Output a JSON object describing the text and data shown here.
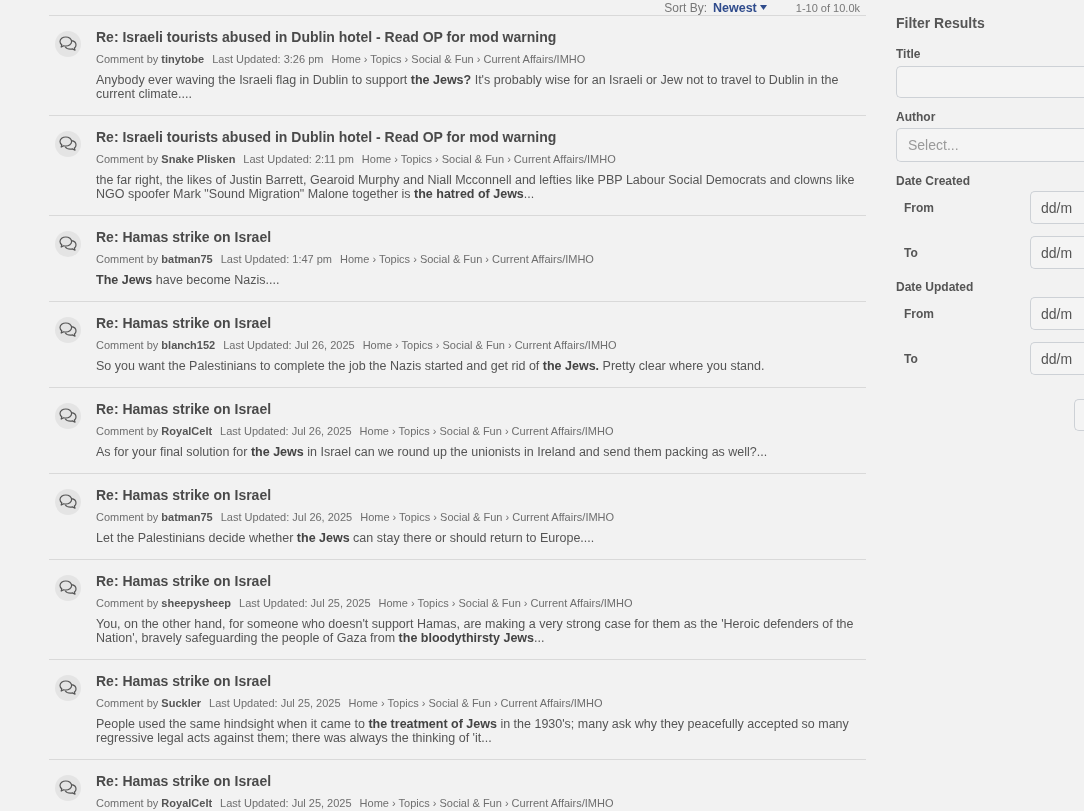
{
  "sort": {
    "label": "Sort By:",
    "value": "Newest"
  },
  "result_count": "1-10 of 10.0k",
  "results": [
    {
      "title": "Re: Israeli tourists abused in Dublin hotel - Read OP for mod warning",
      "author_label": "Comment by",
      "author": "tinytobe",
      "updated": "Last Updated: 3:26 pm",
      "path": "Home › Topics › Social & Fun › Current Affairs/IMHO",
      "excerpt": "Anybody ever waving the Israeli flag in Dublin to support **the Jews?** It's probably wise for an Israeli or Jew not to travel to Dublin in the current climate...."
    },
    {
      "title": "Re: Israeli tourists abused in Dublin hotel - Read OP for mod warning",
      "author_label": "Comment by",
      "author": "Snake Plisken",
      "updated": "Last Updated: 2:11 pm",
      "path": "Home › Topics › Social & Fun › Current Affairs/IMHO",
      "excerpt": "the far right, the likes of Justin Barrett, Gearoid Murphy and Niall Mcconnell and lefties like PBP Labour Social Democrats and clowns like NGO spoofer Mark \"Sound Migration\" Malone together is **the hatred of Jews**..."
    },
    {
      "title": "Re: Hamas strike on Israel",
      "author_label": "Comment by",
      "author": "batman75",
      "updated": "Last Updated: 1:47 pm",
      "path": "Home › Topics › Social & Fun › Current Affairs/IMHO",
      "excerpt": "**The Jews** have become Nazis...."
    },
    {
      "title": "Re: Hamas strike on Israel",
      "author_label": "Comment by",
      "author": "blanch152",
      "updated": "Last Updated: Jul 26, 2025",
      "path": "Home › Topics › Social & Fun › Current Affairs/IMHO",
      "excerpt": "So you want the Palestinians to complete the job the Nazis started and get rid of **the Jews.** Pretty clear where you stand."
    },
    {
      "title": "Re: Hamas strike on Israel",
      "author_label": "Comment by",
      "author": "RoyalCelt",
      "updated": "Last Updated: Jul 26, 2025",
      "path": "Home › Topics › Social & Fun › Current Affairs/IMHO",
      "excerpt": "As for your final solution for **the Jews** in Israel can we round up the unionists in Ireland and send them packing as well?..."
    },
    {
      "title": "Re: Hamas strike on Israel",
      "author_label": "Comment by",
      "author": "batman75",
      "updated": "Last Updated: Jul 26, 2025",
      "path": "Home › Topics › Social & Fun › Current Affairs/IMHO",
      "excerpt": "Let the Palestinians decide whether **the Jews** can stay there or should return to Europe...."
    },
    {
      "title": "Re: Hamas strike on Israel",
      "author_label": "Comment by",
      "author": "sheepysheep",
      "updated": "Last Updated: Jul 25, 2025",
      "path": "Home › Topics › Social & Fun › Current Affairs/IMHO",
      "excerpt": "You, on the other hand, for someone who doesn't support Hamas, are making a very strong case for them as the 'Heroic defenders of the Nation', bravely safeguarding the people of Gaza from **the bloodythirsty Jews**..."
    },
    {
      "title": "Re: Hamas strike on Israel",
      "author_label": "Comment by",
      "author": "Suckler",
      "updated": "Last Updated: Jul 25, 2025",
      "path": "Home › Topics › Social & Fun › Current Affairs/IMHO",
      "excerpt": "People used the same hindsight when it came to **the treatment of Jews** in the 1930's; many ask why they peacefully accepted so many regressive legal acts against them; there was always the thinking of 'it..."
    },
    {
      "title": "Re: Hamas strike on Israel",
      "author_label": "Comment by",
      "author": "RoyalCelt",
      "updated": "Last Updated: Jul 25, 2025",
      "path": "Home › Topics › Social & Fun › Current Affairs/IMHO"
    }
  ],
  "filter": {
    "heading": "Filter Results",
    "fields": [
      {
        "kind": "text",
        "label": "Title"
      },
      {
        "kind": "select",
        "label": "Author",
        "placeholder": "Select..."
      }
    ],
    "date_groups": [
      {
        "label": "Date Created",
        "rows": [
          {
            "label": "From",
            "placeholder": "dd/m"
          },
          {
            "label": "To",
            "placeholder": "dd/m"
          }
        ]
      },
      {
        "label": "Date Updated",
        "rows": [
          {
            "label": "From",
            "placeholder": "dd/m"
          },
          {
            "label": "To",
            "placeholder": "dd/m"
          }
        ]
      }
    ]
  }
}
